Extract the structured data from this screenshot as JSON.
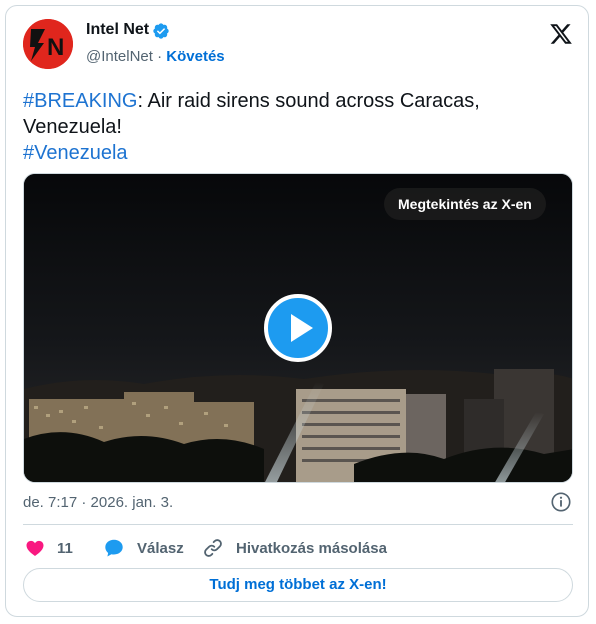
{
  "author": {
    "name": "Intel Net",
    "handle": "@IntelNet",
    "separator": " · ",
    "follow_label": "Követés",
    "avatar_letters": "N"
  },
  "tweet": {
    "hashtag1": "#BREAKING",
    "text_line1": ": Air raid sirens sound across Caracas,",
    "text_line2": "Venezuela!",
    "hashtag2": "#Venezuela"
  },
  "media": {
    "watch_label": "Megtekintés az X-en"
  },
  "meta": {
    "timestamp": "de. 7:17 · 2026. jan. 3."
  },
  "actions": {
    "like_count": "11",
    "reply_label": "Válasz",
    "copy_link_label": "Hivatkozás másolása"
  },
  "footer": {
    "read_more_label": "Tudj meg többet az X-en!"
  },
  "colors": {
    "accent": "#1d9bf0",
    "link": "#006fd6",
    "heart": "#f91880",
    "avatar_bg": "#e0261d"
  },
  "icons": [
    "verified-badge-icon",
    "x-logo-icon",
    "play-icon",
    "info-icon",
    "heart-icon",
    "reply-bubble-icon",
    "link-icon"
  ]
}
